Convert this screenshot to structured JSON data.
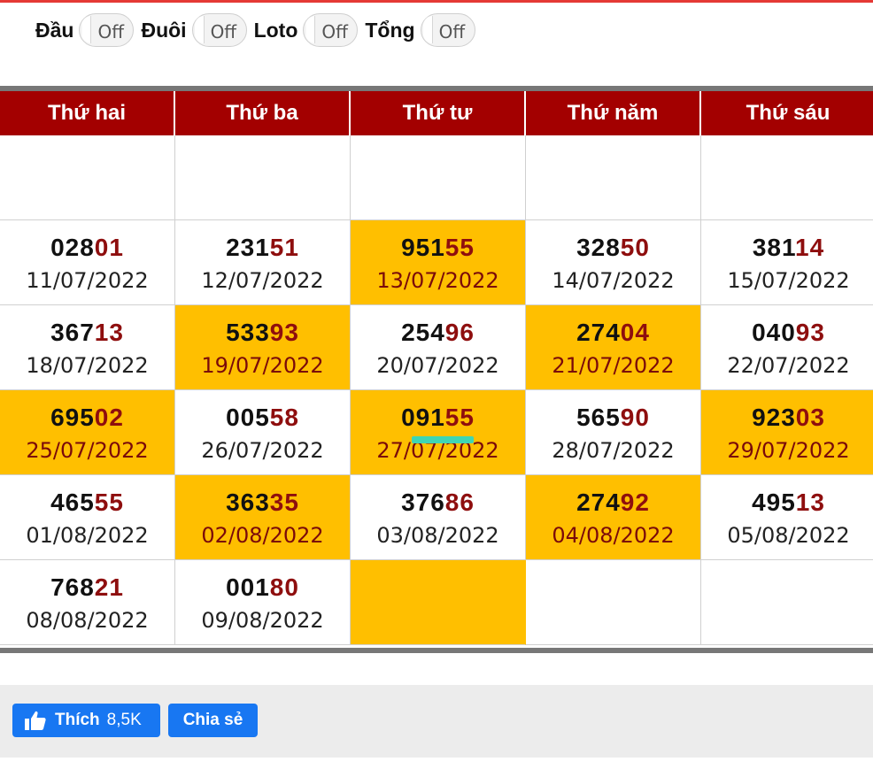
{
  "toggles": [
    {
      "label": "Đầu",
      "state": "Off"
    },
    {
      "label": "Đuôi",
      "state": "Off"
    },
    {
      "label": "Loto",
      "state": "Off"
    },
    {
      "label": "Tổng",
      "state": "Off"
    }
  ],
  "calendar": {
    "headers": [
      "Thứ hai",
      "Thứ ba",
      "Thứ tư",
      "Thứ năm",
      "Thứ sáu"
    ],
    "rows": [
      [
        {
          "head": "",
          "tail": "",
          "date": "",
          "highlight": false
        },
        {
          "head": "",
          "tail": "",
          "date": "",
          "highlight": false
        },
        {
          "head": "",
          "tail": "",
          "date": "",
          "highlight": false
        },
        {
          "head": "",
          "tail": "",
          "date": "",
          "highlight": false
        },
        {
          "head": "",
          "tail": "",
          "date": "",
          "highlight": false
        }
      ],
      [
        {
          "head": "028",
          "tail": "01",
          "date": "11/07/2022",
          "highlight": false
        },
        {
          "head": "231",
          "tail": "51",
          "date": "12/07/2022",
          "highlight": false
        },
        {
          "head": "951",
          "tail": "55",
          "date": "13/07/2022",
          "highlight": true
        },
        {
          "head": "328",
          "tail": "50",
          "date": "14/07/2022",
          "highlight": false
        },
        {
          "head": "381",
          "tail": "14",
          "date": "15/07/2022",
          "highlight": false
        }
      ],
      [
        {
          "head": "367",
          "tail": "13",
          "date": "18/07/2022",
          "highlight": false
        },
        {
          "head": "533",
          "tail": "93",
          "date": "19/07/2022",
          "highlight": true
        },
        {
          "head": "254",
          "tail": "96",
          "date": "20/07/2022",
          "highlight": false
        },
        {
          "head": "274",
          "tail": "04",
          "date": "21/07/2022",
          "highlight": true
        },
        {
          "head": "040",
          "tail": "93",
          "date": "22/07/2022",
          "highlight": false
        }
      ],
      [
        {
          "head": "695",
          "tail": "02",
          "date": "25/07/2022",
          "highlight": true
        },
        {
          "head": "005",
          "tail": "58",
          "date": "26/07/2022",
          "highlight": false
        },
        {
          "head": "091",
          "tail": "55",
          "date": "27/07/2022",
          "highlight": true
        },
        {
          "head": "565",
          "tail": "90",
          "date": "28/07/2022",
          "highlight": false
        },
        {
          "head": "923",
          "tail": "03",
          "date": "29/07/2022",
          "highlight": true
        }
      ],
      [
        {
          "head": "465",
          "tail": "55",
          "date": "01/08/2022",
          "highlight": false
        },
        {
          "head": "363",
          "tail": "35",
          "date": "02/08/2022",
          "highlight": true
        },
        {
          "head": "376",
          "tail": "86",
          "date": "03/08/2022",
          "highlight": false
        },
        {
          "head": "274",
          "tail": "92",
          "date": "04/08/2022",
          "highlight": true
        },
        {
          "head": "495",
          "tail": "13",
          "date": "05/08/2022",
          "highlight": false
        }
      ],
      [
        {
          "head": "768",
          "tail": "21",
          "date": "08/08/2022",
          "highlight": false
        },
        {
          "head": "001",
          "tail": "80",
          "date": "09/08/2022",
          "highlight": false
        },
        {
          "head": "",
          "tail": "",
          "date": "",
          "highlight": true
        },
        {
          "head": "",
          "tail": "",
          "date": "",
          "highlight": false
        },
        {
          "head": "",
          "tail": "",
          "date": "",
          "highlight": false
        }
      ]
    ]
  },
  "social": {
    "like_label": "Thích",
    "like_count": "8,5K",
    "share_label": "Chia sẻ"
  },
  "colors": {
    "header_bg": "#a30000",
    "highlight": "#ffbf00",
    "tail_digits": "#8e0e0e",
    "facebook": "#1877f2"
  }
}
